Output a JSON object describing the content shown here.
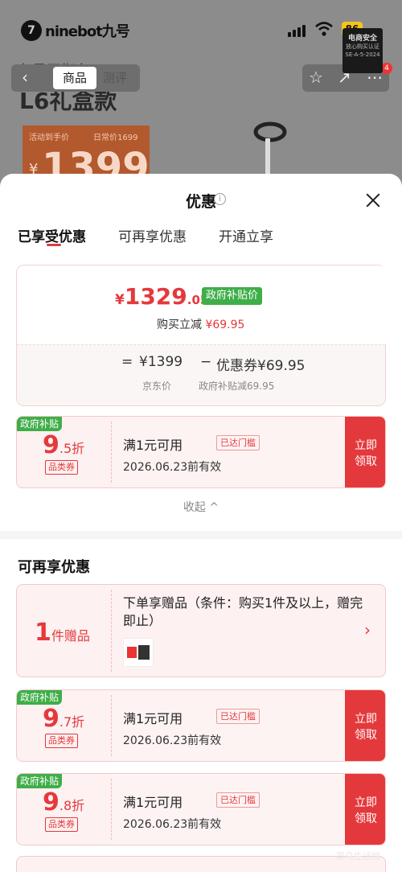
{
  "background": {
    "status_bar": {
      "app_logo": "ninebot-logo",
      "logo_text": "ninebot九号",
      "battery": "86"
    },
    "security_seal": {
      "title": "电商安全",
      "line2": "放心购买认证",
      "line3": "SE-A-5-2024"
    },
    "nav": {
      "tab_goods": "商品",
      "tab_review": "测评",
      "cart_count": "4"
    },
    "product": {
      "title_line1": "九号平衡车",
      "title_line2": "L6礼盒款"
    },
    "price_card": {
      "hint": "活动到手价",
      "daily": "日常价1699",
      "yen": "¥",
      "price": "1399"
    }
  },
  "sheet": {
    "title": "优惠",
    "info_icon": "i",
    "tabs": [
      "已享受优惠",
      "可再享优惠",
      "开通立享"
    ],
    "summary": {
      "yen": "¥",
      "price_int": "1329",
      "price_dec": ".05",
      "price_tag": "政府补贴价",
      "reduce_label": "购买立减",
      "reduce_value": "¥69.95",
      "eq": "=",
      "jd_price": "¥1399",
      "minus": "−",
      "coupon_label": "优惠券¥69.95",
      "jd_price_label": "京东价",
      "gov_label": "政府补贴减69.95"
    },
    "coupons_enjoyed": [
      {
        "tag": "政府补贴",
        "disc_big": "9",
        "disc_small": ".5折",
        "category": "品类券",
        "condition": "满1元可用",
        "met": "已达门槛",
        "date": "2026.06.23前有效",
        "action": "立即领取"
      }
    ],
    "collapse_label": "收起 ^",
    "section_title": "可再享优惠",
    "gift": {
      "count": "1",
      "unit": "件赠品",
      "desc": "下单享赠品（条件：购买1件及以上，赠完即止）",
      "arrow": "›"
    },
    "coupons_more": [
      {
        "tag": "政府补贴",
        "disc_big": "9",
        "disc_small": ".7折",
        "category": "品类券",
        "condition": "满1元可用",
        "met": "已达门槛",
        "date": "2026.06.23前有效",
        "action": "立即领取"
      },
      {
        "tag": "政府补贴",
        "disc_big": "9",
        "disc_small": ".8折",
        "category": "品类券",
        "condition": "满1元可用",
        "met": "已达门槛",
        "date": "2026.06.23前有效",
        "action": "立即领取"
      }
    ],
    "watermark": "菜鸟生活馆"
  },
  "colors": {
    "accent_red": "#e4393c",
    "gov_green": "#3fae49",
    "overlay": "#8c8c8c"
  }
}
